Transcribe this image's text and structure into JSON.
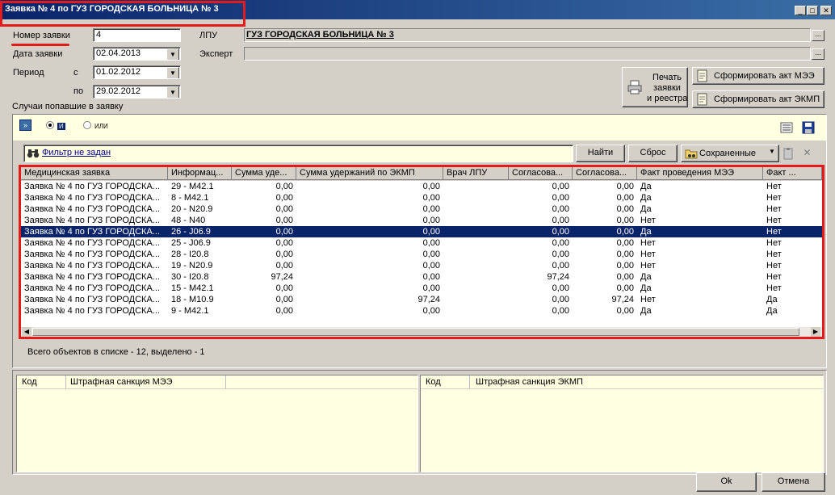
{
  "window": {
    "title": "Заявка № 4  по ГУЗ ГОРОДСКАЯ БОЛЬНИЦА № 3",
    "min_glyph": "_",
    "max_glyph": "□",
    "close_glyph": "✕"
  },
  "form": {
    "number_label": "Номер заявки",
    "number_value": "4",
    "date_label": "Дата заявки",
    "date_value": "02.04.2013",
    "period_label": "Период",
    "from_label": "с",
    "from_value": "01.02.2012",
    "to_label": "по",
    "to_value": "29.02.2012",
    "lpu_label": "ЛПУ",
    "lpu_value": "ГУЗ ГОРОДСКАЯ БОЛЬНИЦА № 3",
    "expert_label": "Эксперт",
    "expert_value": ""
  },
  "buttons": {
    "print": "Печать\nзаявки\nи реестра",
    "act_mee": "Сформировать акт МЭЭ",
    "act_ekmp": "Сформировать акт ЭКМП",
    "ok": "Ok",
    "cancel": "Отмена",
    "find": "Найти",
    "reset": "Сброс",
    "saved": "Сохраненные"
  },
  "cases": {
    "label": "Случаи попавшие в заявку",
    "radio_and": "И",
    "radio_or": "ИЛИ",
    "filter_text": "Фильтр не задан",
    "columns": [
      "Медицинская заявка",
      "Информац...",
      "Сумма уде...",
      "Сумма удержаний по ЭКМП",
      "Врач ЛПУ",
      "Согласова...",
      "Согласова...",
      "Факт проведения МЭЭ",
      "Факт ..."
    ],
    "rows": [
      [
        "Заявка № 4  по ГУЗ ГОРОДСКА...",
        "29 - M42.1",
        "0,00",
        "0,00",
        "",
        "0,00",
        "0,00",
        "Да",
        "Нет"
      ],
      [
        "Заявка № 4  по ГУЗ ГОРОДСКА...",
        "8 - M42.1",
        "0,00",
        "0,00",
        "",
        "0,00",
        "0,00",
        "Да",
        "Нет"
      ],
      [
        "Заявка № 4  по ГУЗ ГОРОДСКА...",
        "20 - N20.9",
        "0,00",
        "0,00",
        "",
        "0,00",
        "0,00",
        "Да",
        "Нет"
      ],
      [
        "Заявка № 4  по ГУЗ ГОРОДСКА...",
        "48 - N40",
        "0,00",
        "0,00",
        "",
        "0,00",
        "0,00",
        "Нет",
        "Нет"
      ],
      [
        "Заявка № 4  по ГУЗ ГОРОДСКА...",
        "26 - J06.9",
        "0,00",
        "0,00",
        "",
        "0,00",
        "0,00",
        "Да",
        "Нет"
      ],
      [
        "Заявка № 4  по ГУЗ ГОРОДСКА...",
        "25 - J06.9",
        "0,00",
        "0,00",
        "",
        "0,00",
        "0,00",
        "Нет",
        "Нет"
      ],
      [
        "Заявка № 4  по ГУЗ ГОРОДСКА...",
        "28 - I20.8",
        "0,00",
        "0,00",
        "",
        "0,00",
        "0,00",
        "Нет",
        "Нет"
      ],
      [
        "Заявка № 4  по ГУЗ ГОРОДСКА...",
        "19 - N20.9",
        "0,00",
        "0,00",
        "",
        "0,00",
        "0,00",
        "Нет",
        "Нет"
      ],
      [
        "Заявка № 4  по ГУЗ ГОРОДСКА...",
        "30 - I20.8",
        "97,24",
        "0,00",
        "",
        "97,24",
        "0,00",
        "Да",
        "Нет"
      ],
      [
        "Заявка № 4  по ГУЗ ГОРОДСКА...",
        "15 - M42.1",
        "0,00",
        "0,00",
        "",
        "0,00",
        "0,00",
        "Да",
        "Нет"
      ],
      [
        "Заявка № 4  по ГУЗ ГОРОДСКА...",
        "18 - M10.9",
        "0,00",
        "97,24",
        "",
        "0,00",
        "97,24",
        "Нет",
        "Да"
      ],
      [
        "Заявка № 4  по ГУЗ ГОРОДСКА...",
        "9 - M42.1",
        "0,00",
        "0,00",
        "",
        "0,00",
        "0,00",
        "Да",
        "Да"
      ]
    ],
    "selected_row": 4,
    "status": "Всего объектов в списке - 12, выделено - 1"
  },
  "sanctions": {
    "mee_code": "Код",
    "mee_title": "Штрафная санкция МЭЭ",
    "ekmp_code": "Код",
    "ekmp_title": "Штрафная санкция ЭКМП"
  }
}
